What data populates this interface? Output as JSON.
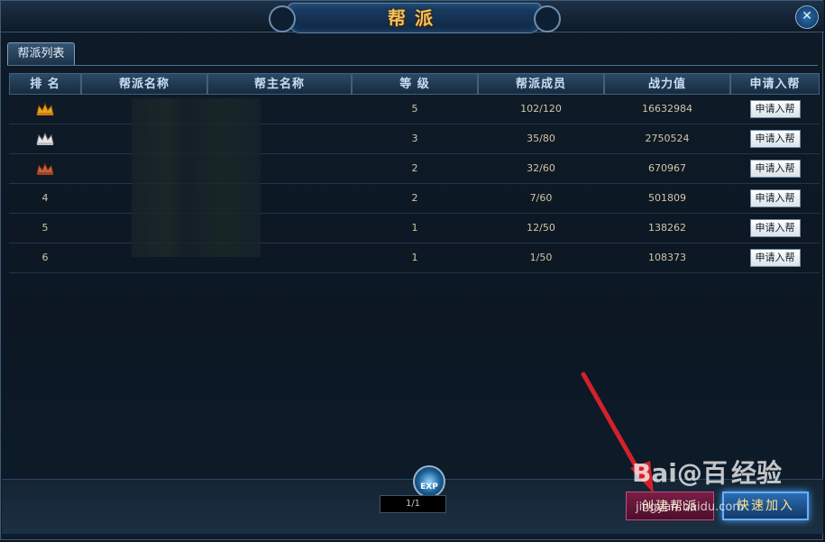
{
  "window": {
    "title": "帮派",
    "close_icon": "close-x-icon"
  },
  "tabs": [
    {
      "label": "帮派列表",
      "active": true
    }
  ],
  "table": {
    "headers": [
      "排 名",
      "帮派名称",
      "帮主名称",
      "等 级",
      "帮派成员",
      "战力值",
      "申请入帮"
    ],
    "rows": [
      {
        "rank": "",
        "rank_icon": "gold-crown-icon",
        "level": "5",
        "members": "102/120",
        "power": "16632984",
        "join": "申请入帮"
      },
      {
        "rank": "",
        "rank_icon": "silver-crown-icon",
        "level": "3",
        "members": "35/80",
        "power": "2750524",
        "join": "申请入帮"
      },
      {
        "rank": "",
        "rank_icon": "bronze-crown-icon",
        "level": "2",
        "members": "32/60",
        "power": "670967",
        "join": "申请入帮"
      },
      {
        "rank": "4",
        "level": "2",
        "members": "7/60",
        "power": "501809",
        "join": "申请入帮"
      },
      {
        "rank": "5",
        "level": "1",
        "members": "12/50",
        "power": "138262",
        "join": "申请入帮"
      },
      {
        "rank": "6",
        "level": "1",
        "members": "1/50",
        "power": "108373",
        "join": "申请入帮"
      }
    ]
  },
  "footer": {
    "exp_label": "EXP",
    "page": "1/1",
    "create_button": "创建帮派",
    "quick_join_button": "快速加入"
  },
  "watermark": {
    "logo": "Bai@百",
    "brand": "经验",
    "url": "jingyan.baidu.com"
  },
  "colors": {
    "title_gold": "#f1c35c",
    "annotation_arrow": "#d4202a"
  }
}
